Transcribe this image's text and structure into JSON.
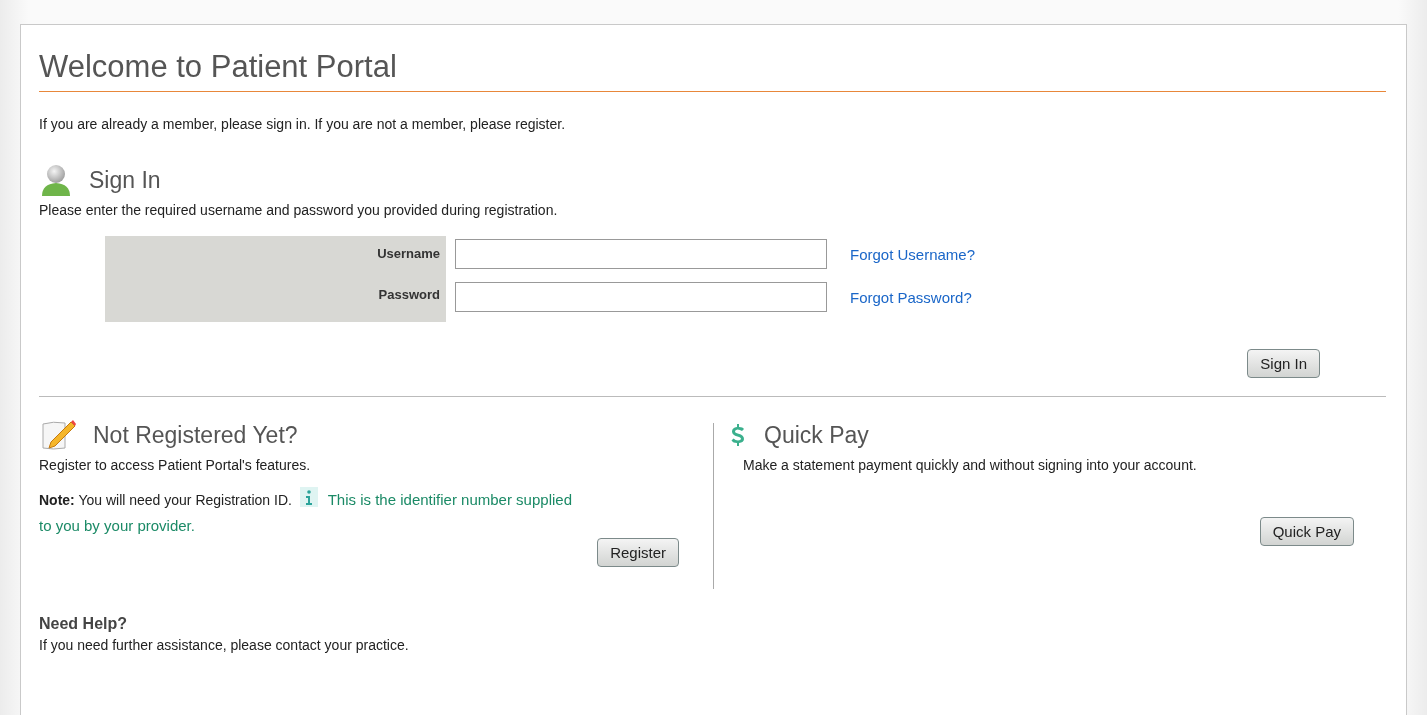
{
  "title": "Welcome to Patient Portal",
  "intro": "If you are already a member, please sign in. If you are not a member, please register.",
  "sign_in": {
    "heading": "Sign In",
    "description": "Please enter the required username and password you provided during registration.",
    "fields": [
      {
        "label": "Username",
        "link": "Forgot Username?"
      },
      {
        "label": "Password",
        "link": "Forgot Password?"
      }
    ],
    "button": "Sign In"
  },
  "register": {
    "heading": "Not Registered Yet?",
    "description": "Register to access Patient Portal's features.",
    "note": "**Note:** You will need your Registration ID.",
    "hint": [
      "This is the identifier number supplied",
      "to you by your provider."
    ],
    "button": "Register"
  },
  "quick_pay": {
    "heading": "Quick Pay",
    "description": "Make a statement payment quickly and without signing into your account.",
    "button": "Quick Pay"
  },
  "help": {
    "heading": "Need Help?",
    "text": "If you need further assistance, please contact your practice."
  }
}
